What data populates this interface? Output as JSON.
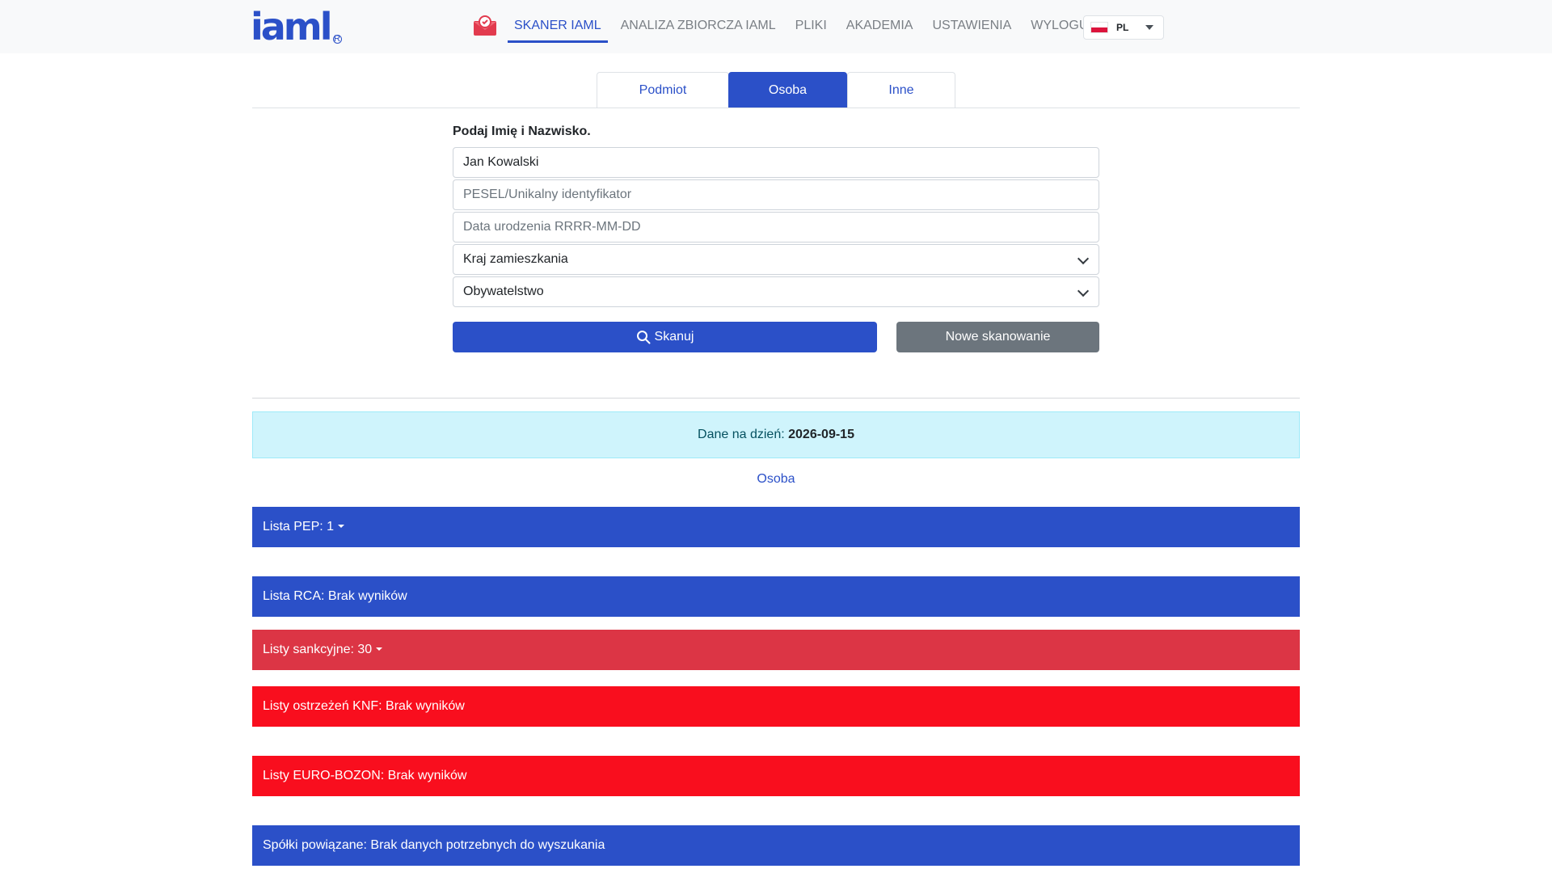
{
  "logo": {
    "text": "iaml",
    "reg": "R"
  },
  "nav": {
    "items": [
      "SKANER IAML",
      "ANALIZA ZBIORCZA IAML",
      "PLIKI",
      "AKADEMIA",
      "USTAWIENIA",
      "WYLOGUJ"
    ],
    "active": "SKANER IAML",
    "language": "PL"
  },
  "tabs": [
    "Podmiot",
    "Osoba",
    "Inne"
  ],
  "active_tab": "Osoba",
  "form": {
    "label": "Podaj Imię i Nazwisko.",
    "name_value": "Jan Kowalski",
    "pesel_placeholder": "PESEL/Unikalny identyfikator",
    "dob_placeholder": "Data urodzenia RRRR-MM-DD",
    "country_select": "Kraj zamieszkania",
    "citizenship_select": "Obywatelstwo",
    "scan_button": "Skanuj",
    "new_scan_button": "Nowe skanowanie"
  },
  "info": {
    "label": "Dane na dzień:",
    "date": "2026-09-15"
  },
  "section_title": "Osoba",
  "results": [
    {
      "label": "Lista PEP: 1",
      "color": "#2b50c8",
      "dropdown": true
    },
    {
      "label": "Lista RCA: Brak wyników",
      "color": "#2b50c8",
      "dropdown": false
    },
    {
      "label": "Listy sankcyjne: 30",
      "color": "#dc3545",
      "dropdown": true
    },
    {
      "label": "Listy ostrzeżeń KNF: Brak wyników",
      "color": "#f90e1e",
      "dropdown": false
    },
    {
      "label": "Listy EURO-BOZON: Brak wyników",
      "color": "#f90e1e",
      "dropdown": false
    },
    {
      "label": "Spółki powiązane: Brak danych potrzebnych do wyszukania",
      "color": "#2b50c8",
      "dropdown": false
    }
  ],
  "icons": {
    "scan": "search-icon",
    "nav": "envelope-shield-icon"
  }
}
